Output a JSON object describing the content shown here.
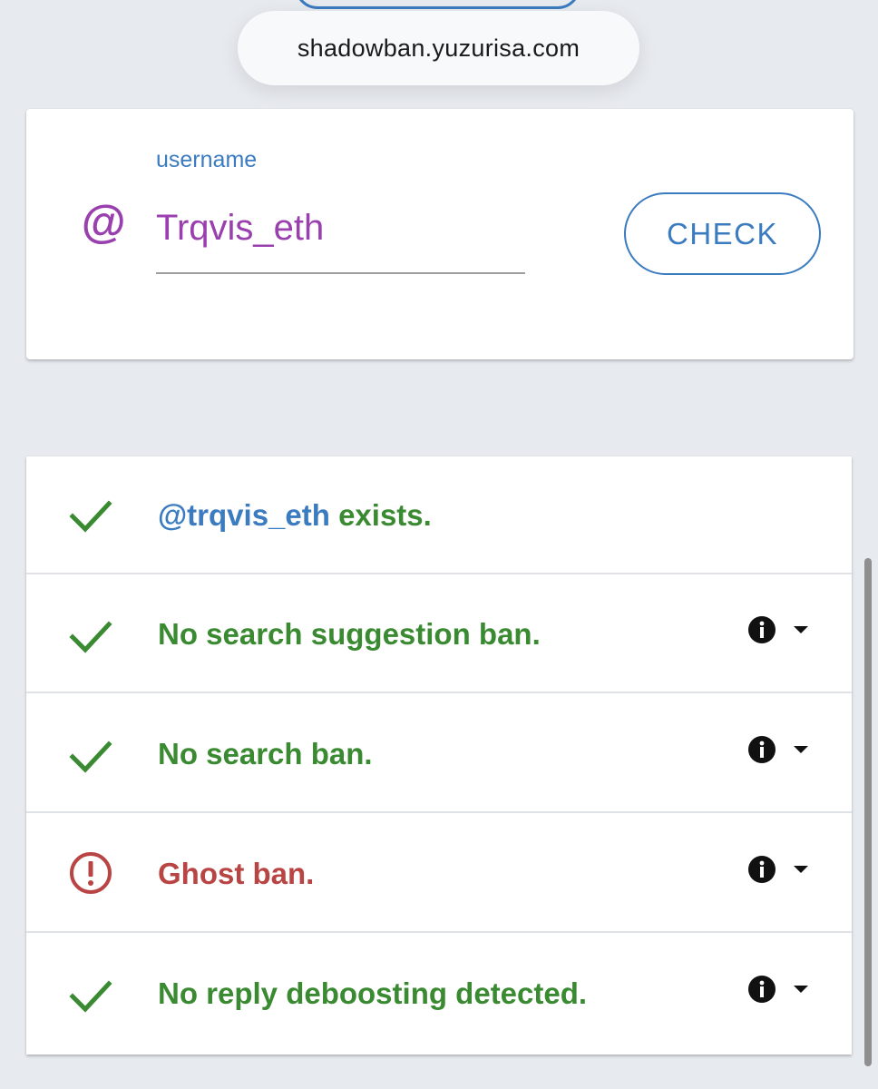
{
  "browser": {
    "url": "shadowban.yuzurisa.com"
  },
  "search": {
    "label": "username",
    "at_symbol": "@",
    "value": "Trqvis_eth",
    "check_label": "CHECK"
  },
  "results": {
    "exists": {
      "handle": "@trqvis_eth",
      "suffix": " exists.",
      "status": "ok",
      "icon": "check-icon"
    },
    "items": [
      {
        "text": "No search suggestion ban.",
        "status": "ok",
        "icon": "check-icon"
      },
      {
        "text": "No search ban.",
        "status": "ok",
        "icon": "check-icon"
      },
      {
        "text": "Ghost ban.",
        "status": "banned",
        "icon": "alert-circle-icon"
      },
      {
        "text": "No reply deboosting detected.",
        "status": "ok",
        "icon": "check-icon"
      }
    ]
  },
  "colors": {
    "ok": "#3a8a32",
    "banned": "#b84444",
    "accent": "#3b7bbf",
    "username": "#9a3fae",
    "background": "#e7eaef"
  }
}
